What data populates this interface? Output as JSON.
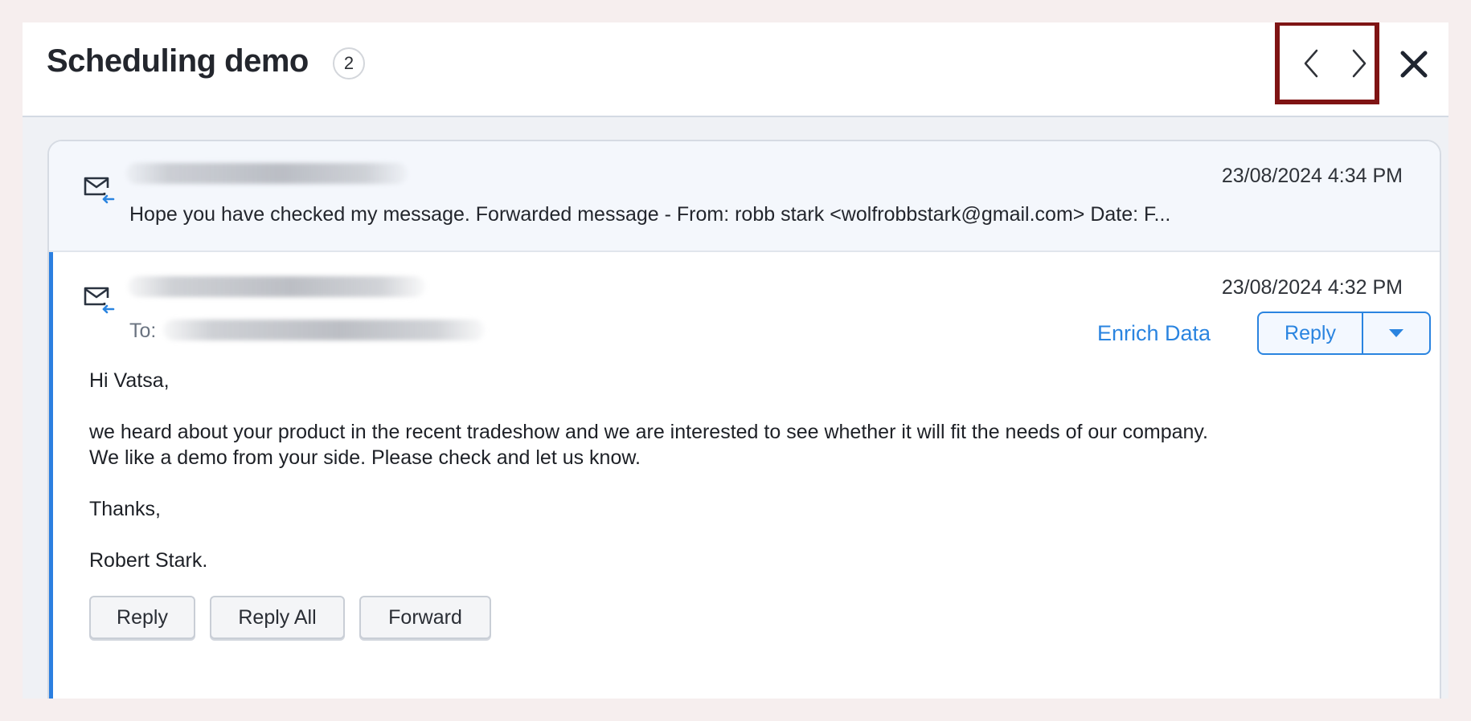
{
  "header": {
    "title": "Scheduling demo",
    "count": "2"
  },
  "emails": [
    {
      "date": "23/08/2024 4:34 PM",
      "snippet": "Hope you have checked my message. Forwarded message - From: robb stark <wolfrobbstark@gmail.com> Date: F..."
    },
    {
      "date": "23/08/2024 4:32 PM",
      "to_label": "To:",
      "enrich_label": "Enrich Data",
      "reply_label": "Reply",
      "body": {
        "greeting": "Hi Vatsa,",
        "line1": "we heard about your product in the recent tradeshow and we are interested to see whether it will fit the needs of our company.",
        "line2": "We like a demo from your side. Please check and let us know.",
        "thanks": "Thanks,",
        "signature": "Robert Stark."
      },
      "actions": {
        "reply": "Reply",
        "reply_all": "Reply All",
        "forward": "Forward"
      }
    }
  ],
  "colors": {
    "accent": "#2a84e0",
    "highlight_border": "#7f1414"
  },
  "icons": {
    "prev": "chevron-left-icon",
    "next": "chevron-right-icon",
    "close": "close-icon",
    "mail": "mail-incoming-icon",
    "dropdown": "caret-down-icon"
  }
}
